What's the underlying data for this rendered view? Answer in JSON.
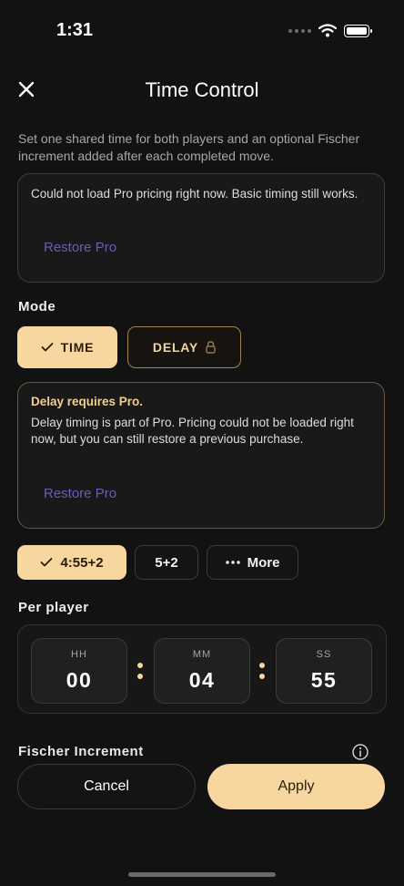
{
  "status_bar": {
    "time": "1:31"
  },
  "header": {
    "title": "Time Control"
  },
  "description": "Set one shared time for both players and an optional Fischer increment added after each completed move.",
  "pricing_notice": {
    "message": "Could not load Pro pricing right now. Basic timing still works.",
    "restore_label": "Restore Pro"
  },
  "mode": {
    "label": "Mode",
    "options": [
      {
        "label": "TIME",
        "selected": true
      },
      {
        "label": "DELAY",
        "locked": true
      }
    ]
  },
  "delay_notice": {
    "heading": "Delay requires Pro.",
    "message": "Delay timing is part of Pro. Pricing could not be loaded right now, but you can still restore a previous purchase.",
    "restore_label": "Restore Pro"
  },
  "presets": [
    {
      "label": "4:55+2",
      "selected": true
    },
    {
      "label": "5+2"
    },
    {
      "label": "More"
    }
  ],
  "per_player": {
    "label": "Per player",
    "hours": {
      "label": "HH",
      "value": "00"
    },
    "minutes": {
      "label": "MM",
      "value": "04"
    },
    "seconds": {
      "label": "SS",
      "value": "55"
    }
  },
  "fischer": {
    "label": "Fischer Increment"
  },
  "actions": {
    "cancel": "Cancel",
    "apply": "Apply"
  },
  "icons": {
    "close": "close-icon",
    "check": "check-icon",
    "lock": "lock-icon",
    "more": "ellipsis-icon",
    "info": "info-icon",
    "wifi": "wifi-icon",
    "battery": "battery-icon"
  },
  "colors": {
    "accent": "#f8d6a0",
    "restore_link": "#6e5bb4",
    "background": "#121212"
  }
}
